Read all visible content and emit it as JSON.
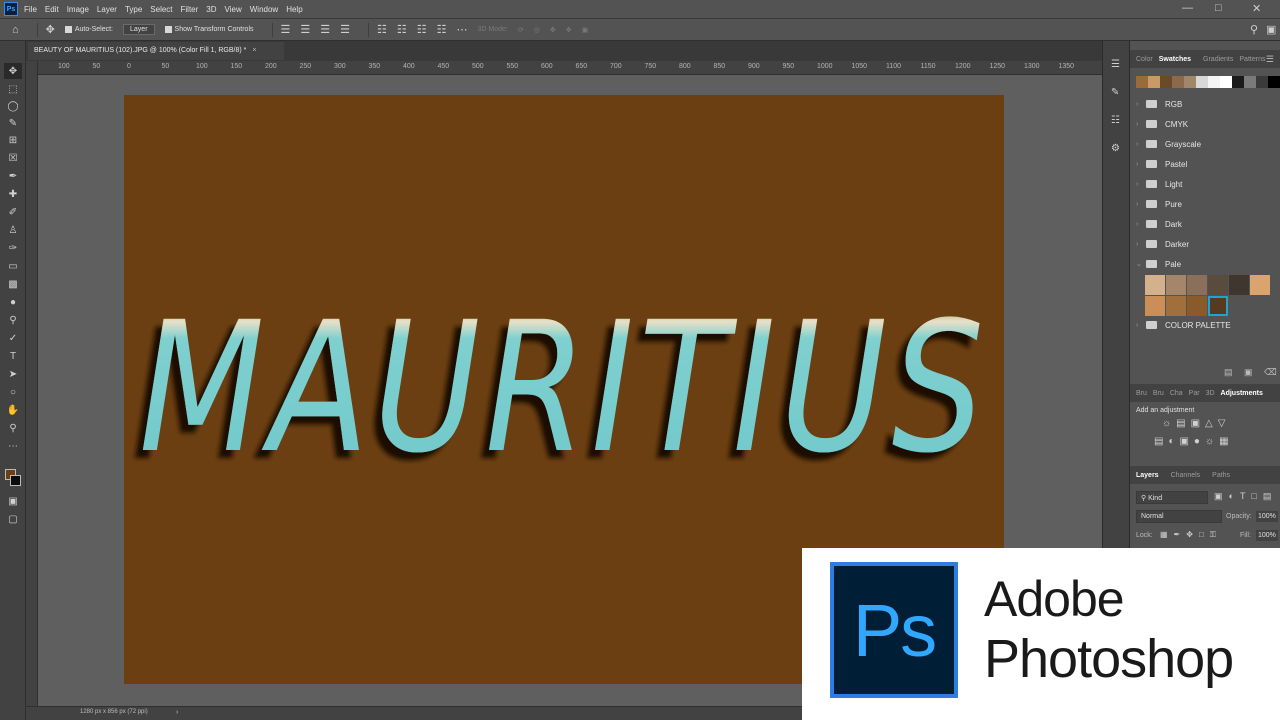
{
  "menu": {
    "items": [
      "File",
      "Edit",
      "Image",
      "Layer",
      "Type",
      "Select",
      "Filter",
      "3D",
      "View",
      "Window",
      "Help"
    ]
  },
  "options": {
    "auto_select": "Auto-Select:",
    "layer_select": "Layer",
    "show_transform": "Show Transform Controls",
    "mode_3d": "3D Mode:"
  },
  "document": {
    "tab_title": "BEAUTY OF MAURITIUS  (102).JPG @ 100% (Color Fill 1, RGB/8) *",
    "canvas_color": "#6b3f11",
    "artwork_text": "MAURITIUS",
    "status": "1280 px x 856 px (72 ppi)"
  },
  "ruler_top": [
    "100",
    "50",
    "0",
    "50",
    "100",
    "150",
    "200",
    "250",
    "300",
    "350",
    "400",
    "450",
    "500",
    "550",
    "600",
    "650",
    "700",
    "750",
    "800",
    "850",
    "900",
    "950",
    "1000",
    "1050",
    "1100",
    "1150",
    "1200",
    "1250",
    "1300",
    "1350"
  ],
  "swatches_panel": {
    "tabs": [
      "Color",
      "Swatches",
      "Gradients",
      "Patterns"
    ],
    "active_tab": "Swatches",
    "recent_colors": [
      "#9b6a3a",
      "#c79a66",
      "#6b4a2a",
      "#8a6a4a",
      "#a0876a",
      "#d8d8d8",
      "#f4f4f4",
      "#ffffff",
      "#1a1a1a",
      "#7a7a7a",
      "#3a3a3a",
      "#000000"
    ],
    "folders": [
      "RGB",
      "CMYK",
      "Grayscale",
      "Pastel",
      "Light",
      "Pure",
      "Dark",
      "Darker",
      "Pale"
    ],
    "pale_row1": [
      "#d4b18a",
      "#a5866a",
      "#8a6f5a",
      "#5a4b3f",
      "#3f3630",
      "#d9a46e"
    ],
    "pale_row2": [
      "#c98f57",
      "#a06f3c",
      "#8a5a2a",
      "#1fa3d4"
    ],
    "color_palette_folder": "COLOR PALETTE"
  },
  "adjustments_panel": {
    "tabs": [
      "Bru",
      "Bru",
      "Cha",
      "Par",
      "3D",
      "Adjustments"
    ],
    "active_tab": "Adjustments",
    "hint": "Add an adjustment"
  },
  "layers_panel": {
    "tabs": [
      "Layers",
      "Channels",
      "Paths"
    ],
    "active_tab": "Layers",
    "kind": "Kind",
    "blend_mode": "Normal",
    "opacity_label": "Opacity:",
    "opacity_value": "100%",
    "lock_label": "Lock:",
    "fill_label": "Fill:",
    "fill_value": "100%"
  },
  "brand": {
    "logo_text": "Ps",
    "line1": "Adobe",
    "line2": "Photoshop"
  }
}
